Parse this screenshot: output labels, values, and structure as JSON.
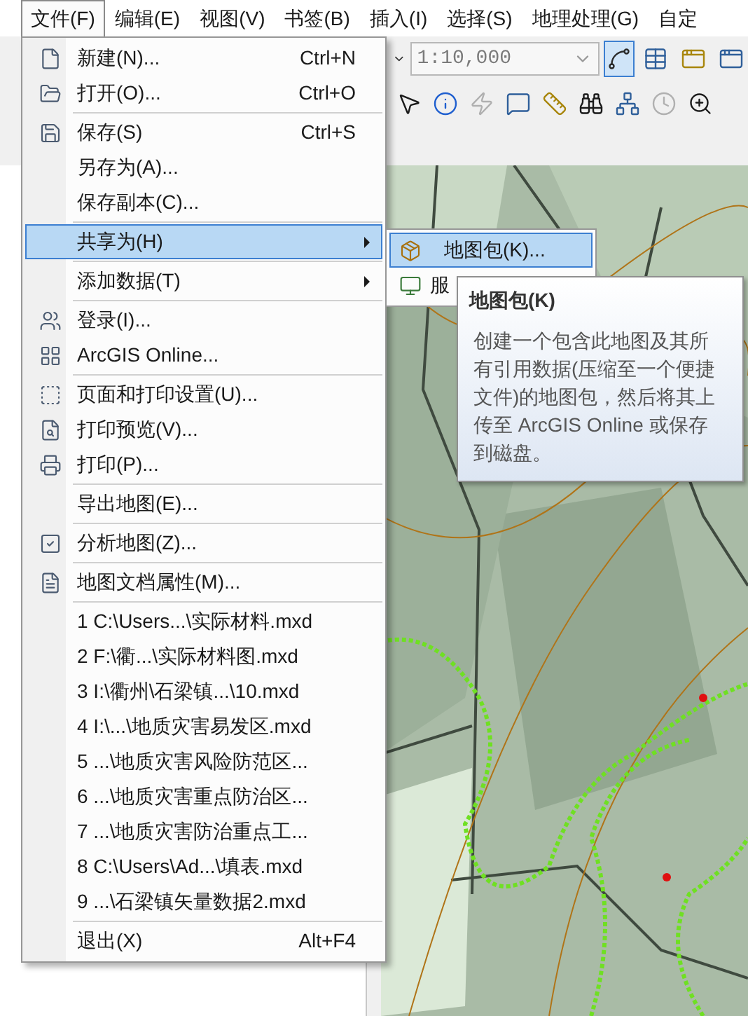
{
  "menubar": [
    {
      "label": "文件(F)",
      "selected": true
    },
    {
      "label": "编辑(E)",
      "selected": false
    },
    {
      "label": "视图(V)",
      "selected": false
    },
    {
      "label": "书签(B)",
      "selected": false
    },
    {
      "label": "插入(I)",
      "selected": false
    },
    {
      "label": "选择(S)",
      "selected": false
    },
    {
      "label": "地理处理(G)",
      "selected": false
    },
    {
      "label": "自定",
      "selected": false
    }
  ],
  "toolbar": {
    "scale": "1:10,000"
  },
  "file_menu": {
    "groups": [
      [
        {
          "label": "新建(N)...",
          "shortcut": "Ctrl+N",
          "has_submenu": false,
          "selected": false
        },
        {
          "label": "打开(O)...",
          "shortcut": "Ctrl+O",
          "has_submenu": false,
          "selected": false
        }
      ],
      [
        {
          "label": "保存(S)",
          "shortcut": "Ctrl+S",
          "has_submenu": false,
          "selected": false
        },
        {
          "label": "另存为(A)...",
          "has_submenu": false,
          "selected": false
        },
        {
          "label": "保存副本(C)...",
          "has_submenu": false,
          "selected": false
        }
      ],
      [
        {
          "label": "共享为(H)",
          "has_submenu": true,
          "selected": true
        }
      ],
      [
        {
          "label": "添加数据(T)",
          "has_submenu": true,
          "selected": false
        }
      ],
      [
        {
          "label": "登录(I)...",
          "has_submenu": false,
          "selected": false
        },
        {
          "label": "ArcGIS Online...",
          "has_submenu": false,
          "selected": false
        }
      ],
      [
        {
          "label": "页面和打印设置(U)...",
          "has_submenu": false,
          "selected": false
        },
        {
          "label": "打印预览(V)...",
          "has_submenu": false,
          "selected": false
        },
        {
          "label": "打印(P)...",
          "has_submenu": false,
          "selected": false
        }
      ],
      [
        {
          "label": "导出地图(E)...",
          "has_submenu": false,
          "selected": false
        }
      ],
      [
        {
          "label": "分析地图(Z)...",
          "has_submenu": false,
          "selected": false
        }
      ],
      [
        {
          "label": "地图文档属性(M)...",
          "has_submenu": false,
          "selected": false
        }
      ],
      [
        {
          "label": "1 C:\\Users...\\实际材料.mxd",
          "has_submenu": false,
          "selected": false
        },
        {
          "label": "2 F:\\衢...\\实际材料图.mxd",
          "has_submenu": false,
          "selected": false
        },
        {
          "label": "3 I:\\衢州\\石梁镇...\\10.mxd",
          "has_submenu": false,
          "selected": false
        },
        {
          "label": "4 I:\\...\\地质灾害易发区.mxd",
          "has_submenu": false,
          "selected": false
        },
        {
          "label": "5 ...\\地质灾害风险防范区...",
          "has_submenu": false,
          "selected": false
        },
        {
          "label": "6 ...\\地质灾害重点防治区...",
          "has_submenu": false,
          "selected": false
        },
        {
          "label": "7 ...\\地质灾害防治重点工...",
          "has_submenu": false,
          "selected": false
        },
        {
          "label": "8 C:\\Users\\Ad...\\填表.mxd",
          "has_submenu": false,
          "selected": false
        },
        {
          "label": "9 ...\\石梁镇矢量数据2.mxd",
          "has_submenu": false,
          "selected": false
        }
      ],
      [
        {
          "label": "退出(X)",
          "shortcut": "Alt+F4",
          "has_submenu": false,
          "selected": false
        }
      ]
    ]
  },
  "share_submenu": {
    "items": [
      {
        "label": "地图包(K)...",
        "selected": true
      },
      {
        "label": "服",
        "selected": false
      }
    ]
  },
  "tooltip": {
    "title": "地图包(K)",
    "body": "创建一个包含此地图及其所有引用数据(压缩至一个便捷文件)的地图包，然后将其上传至 ArcGIS Online 或保存到磁盘。"
  }
}
